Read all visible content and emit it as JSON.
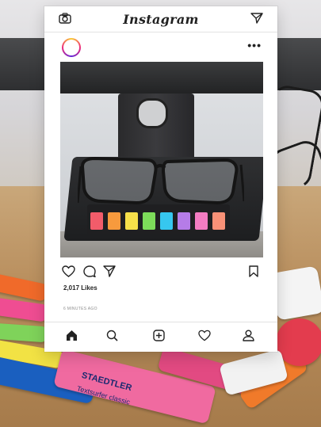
{
  "topbar": {
    "brand": "Instagram",
    "camera_icon": "camera-icon",
    "direct_icon": "paper-plane-icon"
  },
  "post": {
    "more_icon": "ellipsis-icon",
    "more_label": "•••",
    "likes": "2,017 Likes",
    "time": "6 MINUTES AGO",
    "actions": [
      "heart-icon",
      "comment-icon",
      "share-icon",
      "bookmark-icon"
    ]
  },
  "bottom_nav": [
    "home-icon",
    "search-icon",
    "add-post-icon",
    "activity-heart-icon",
    "profile-icon"
  ],
  "background": {
    "pen_brand": "STAEDTLER",
    "pen_model": "Textsurfer classic"
  },
  "colors": {
    "tabs": [
      "#f25c6a",
      "#f79a3d",
      "#f7e04a",
      "#7ddc5a",
      "#36c7ef",
      "#b57ce8",
      "#f37cc2",
      "#f99177"
    ]
  }
}
